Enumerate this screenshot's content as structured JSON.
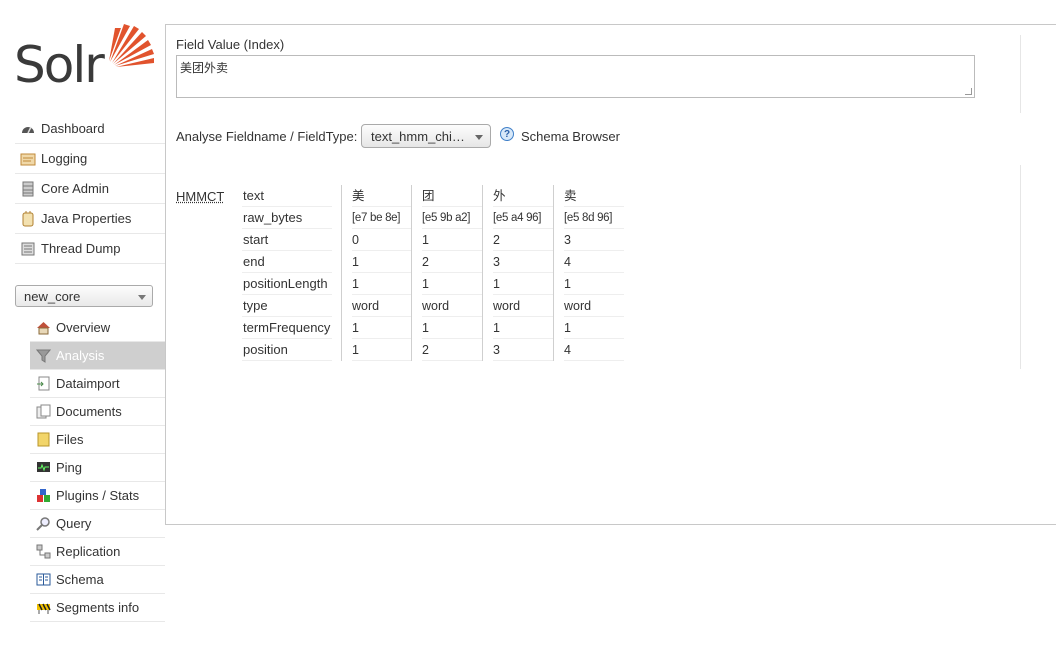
{
  "logo": {
    "text": "Solr"
  },
  "nav": [
    {
      "label": "Dashboard",
      "icon": "dashboard-icon"
    },
    {
      "label": "Logging",
      "icon": "logging-icon"
    },
    {
      "label": "Core Admin",
      "icon": "core-admin-icon"
    },
    {
      "label": "Java Properties",
      "icon": "java-properties-icon"
    },
    {
      "label": "Thread Dump",
      "icon": "thread-dump-icon"
    }
  ],
  "core_selector": {
    "value": "new_core"
  },
  "core_nav": [
    {
      "label": "Overview",
      "icon": "overview-icon"
    },
    {
      "label": "Analysis",
      "icon": "analysis-icon",
      "active": true
    },
    {
      "label": "Dataimport",
      "icon": "dataimport-icon"
    },
    {
      "label": "Documents",
      "icon": "documents-icon"
    },
    {
      "label": "Files",
      "icon": "files-icon"
    },
    {
      "label": "Ping",
      "icon": "ping-icon"
    },
    {
      "label": "Plugins / Stats",
      "icon": "plugins-icon"
    },
    {
      "label": "Query",
      "icon": "query-icon"
    },
    {
      "label": "Replication",
      "icon": "replication-icon"
    },
    {
      "label": "Schema",
      "icon": "schema-icon"
    },
    {
      "label": "Segments info",
      "icon": "segments-icon"
    }
  ],
  "analysis": {
    "field_value_label": "Field Value (Index)",
    "field_value": "美团外卖",
    "fieldtype_label": "Analyse Fieldname / FieldType:",
    "fieldtype_value": "text_hmm_chi…",
    "schema_browser_label": "Schema Browser",
    "help_glyph": "?"
  },
  "tokenizer": {
    "name": "HMMCT",
    "attributes": [
      "text",
      "raw_bytes",
      "start",
      "end",
      "positionLength",
      "type",
      "termFrequency",
      "position"
    ],
    "tokens": [
      {
        "text": "美",
        "raw_bytes": "[e7 be 8e]",
        "start": "0",
        "end": "1",
        "positionLength": "1",
        "type": "word",
        "termFrequency": "1",
        "position": "1"
      },
      {
        "text": "团",
        "raw_bytes": "[e5 9b a2]",
        "start": "1",
        "end": "2",
        "positionLength": "1",
        "type": "word",
        "termFrequency": "1",
        "position": "2"
      },
      {
        "text": "外",
        "raw_bytes": "[e5 a4 96]",
        "start": "2",
        "end": "3",
        "positionLength": "1",
        "type": "word",
        "termFrequency": "1",
        "position": "3"
      },
      {
        "text": "卖",
        "raw_bytes": "[e5 8d 96]",
        "start": "3",
        "end": "4",
        "positionLength": "1",
        "type": "word",
        "termFrequency": "1",
        "position": "4"
      }
    ]
  },
  "colors": {
    "accent": "#e1532d",
    "active_bg": "#cfcfcf"
  }
}
